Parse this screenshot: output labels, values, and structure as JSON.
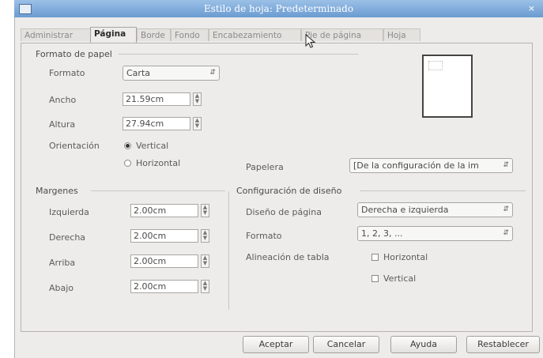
{
  "window": {
    "title": "Estilo de hoja: Predeterminado",
    "close_glyph": "×"
  },
  "tabs": [
    "Administrar",
    "Página",
    "Borde",
    "Fondo",
    "Encabezamiento",
    "Pie de página",
    "Hoja"
  ],
  "paper_format": {
    "section_title": "Formato de papel",
    "format_label": "Formato",
    "format_value": "Carta",
    "width_label": "Ancho",
    "width_value": "21.59cm",
    "height_label": "Altura",
    "height_value": "27.94cm",
    "orientation_label": "Orientación",
    "orientation_options": [
      "Vertical",
      "Horizontal"
    ],
    "orientation_selected": "Vertical",
    "paper_tray_label": "Papelera",
    "paper_tray_value": "[De la configuración de la im"
  },
  "margins": {
    "section_title": "Margenes",
    "left_label": "Izquierda",
    "left_value": "2.00cm",
    "right_label": "Derecha",
    "right_value": "2.00cm",
    "top_label": "Arriba",
    "top_value": "2.00cm",
    "bottom_label": "Abajo",
    "bottom_value": "2.00cm"
  },
  "layout": {
    "section_title": "Configuración de diseño",
    "page_layout_label": "Diseño de página",
    "page_layout_value": "Derecha e izquierda",
    "format_label": "Formato",
    "format_value": "1, 2, 3, ...",
    "table_alignment_label": "Alineación de tabla",
    "horizontal_label": "Horizontal",
    "vertical_label": "Vertical"
  },
  "buttons": {
    "ok": "Aceptar",
    "cancel": "Cancelar",
    "help": "Ayuda",
    "reset": "Restablecer"
  },
  "colors": {
    "titlebar": "#7aa7da",
    "dialog_bg": "#edeceb"
  }
}
